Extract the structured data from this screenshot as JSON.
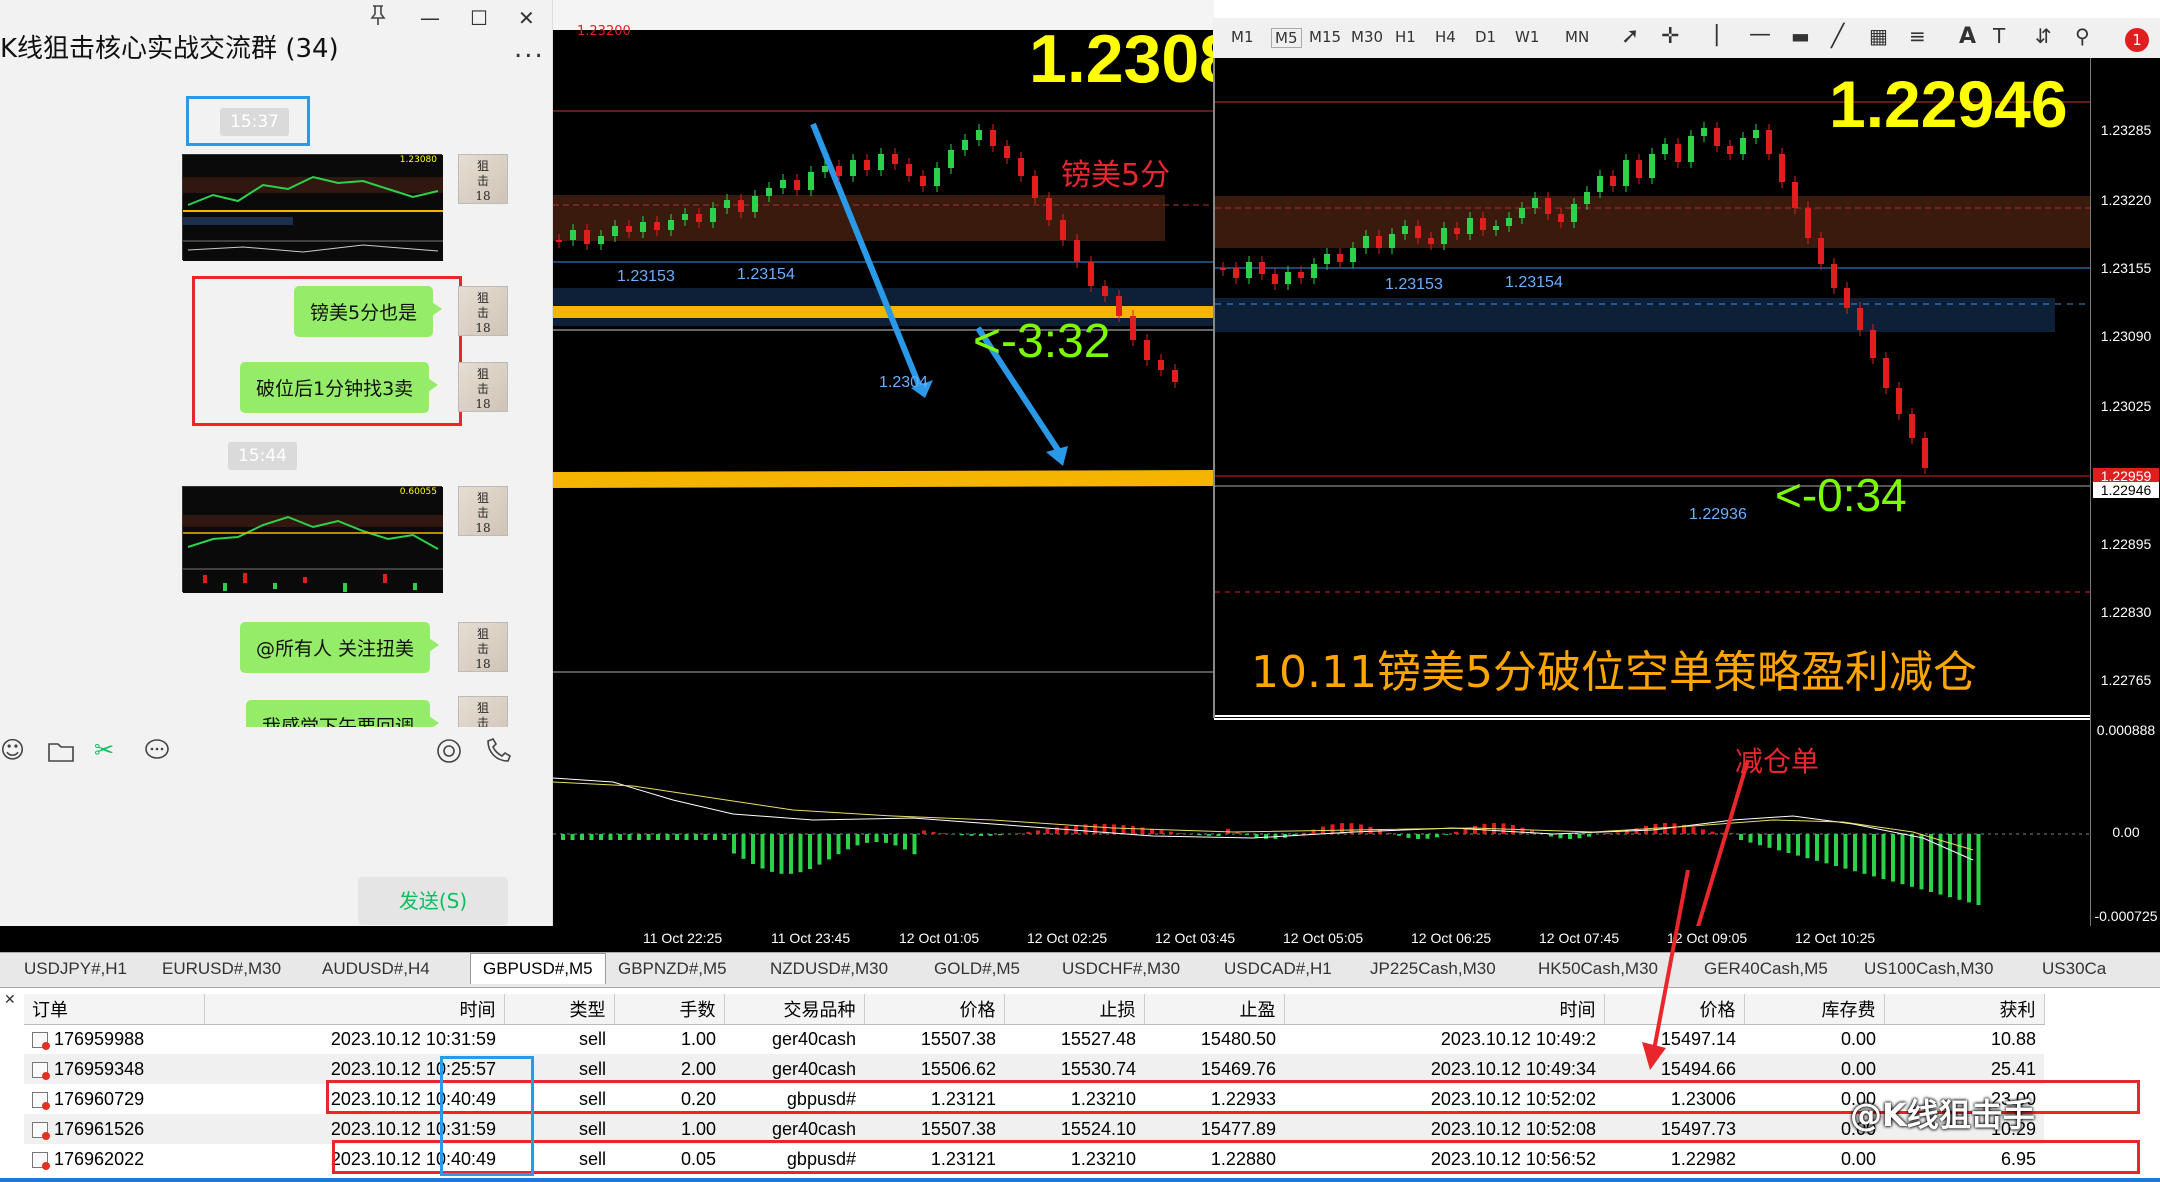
{
  "chat": {
    "title": "K线狙击核心实战交流群 (34)",
    "menu": "...",
    "time1": "15:37",
    "time2": "15:44",
    "msg1": "镑美5分也是",
    "msg2": "破位后1分钟找3卖",
    "msg3": "@所有人 关注扭美",
    "msg4": "我感觉下午要回调",
    "avatar_text": "狙击\n18",
    "send_label": "发送(S)",
    "thumb1_price": "1.23080",
    "thumb2_price": "0.60055"
  },
  "chart_left": {
    "top_price": "1.23200",
    "big_price": "1.2308",
    "label_cn": "镑美5分",
    "level1": "1.23153",
    "level2": "1.23154",
    "low_label": "1.2304",
    "timer": "<-3:32"
  },
  "chart_right": {
    "big_price": "1.22946",
    "level1": "1.23153",
    "level2": "1.23154",
    "low_label": "1.22936",
    "timer": "<-0:34",
    "headline": "10.11镑美5分破位空单策略盈利减仓"
  },
  "macd": {
    "label_cn": "减仓单",
    "scale_top": "0.000888",
    "scale_mid": "0.00",
    "scale_bot": "-0.000725"
  },
  "price_scale": [
    "1.23285",
    "1.23220",
    "1.23155",
    "1.23090",
    "1.23025",
    "1.22959",
    "1.22946",
    "1.22895",
    "1.22830",
    "1.22765"
  ],
  "time_axis": [
    "11 Oct 22:25",
    "11 Oct 23:45",
    "12 Oct 01:05",
    "12 Oct 02:25",
    "12 Oct 03:45",
    "12 Oct 05:05",
    "12 Oct 06:25",
    "12 Oct 07:45",
    "12 Oct 09:05",
    "12 Oct 10:25"
  ],
  "toolbar": {
    "timeframes": [
      "M1",
      "M5",
      "M15",
      "M30",
      "H1",
      "H4",
      "D1",
      "W1",
      "MN"
    ],
    "notif_count": "1"
  },
  "tabs": [
    "USDJPY#,H1",
    "EURUSD#,M30",
    "AUDUSD#,H4",
    "GBPUSD#,M5",
    "GBPNZD#,M5",
    "NZDUSD#,M30",
    "GOLD#,M5",
    "USDCHF#,M30",
    "USDCAD#,H1",
    "JP225Cash,M30",
    "HK50Cash,M30",
    "GER40Cash,M5",
    "US100Cash,M30",
    "US30Ca"
  ],
  "orders": {
    "headers": [
      "订单",
      "时间",
      "类型",
      "手数",
      "交易品种",
      "价格",
      "止损",
      "止盈",
      "时间",
      "价格",
      "库存费",
      "获利"
    ],
    "rows": [
      [
        "176959988",
        "2023.10.12 10:31:59",
        "sell",
        "1.00",
        "ger40cash",
        "15507.38",
        "15527.48",
        "15480.50",
        "2023.10.12 10:49:2",
        "15497.14",
        "0.00",
        "10.88"
      ],
      [
        "176959348",
        "2023.10.12 10:25:57",
        "sell",
        "2.00",
        "ger40cash",
        "15506.62",
        "15530.74",
        "15469.76",
        "2023.10.12 10:49:34",
        "15494.66",
        "0.00",
        "25.41"
      ],
      [
        "176960729",
        "2023.10.12 10:40:49",
        "sell",
        "0.20",
        "gbpusd#",
        "1.23121",
        "1.23210",
        "1.22933",
        "2023.10.12 10:52:02",
        "1.23006",
        "0.00",
        "23.00"
      ],
      [
        "176961526",
        "2023.10.12 10:31:59",
        "sell",
        "1.00",
        "ger40cash",
        "15507.38",
        "15524.10",
        "15477.89",
        "2023.10.12 10:52:08",
        "15497.73",
        "0.00",
        "10.29"
      ],
      [
        "176962022",
        "2023.10.12 10:40:49",
        "sell",
        "0.05",
        "gbpusd#",
        "1.23121",
        "1.23210",
        "1.22880",
        "2023.10.12 10:56:52",
        "1.22982",
        "0.00",
        "6.95"
      ]
    ]
  },
  "watermark": "@K线狙击手",
  "colors": {
    "bubble": "#95ec69",
    "bull": "#2bd24a",
    "bear": "#e01e1e",
    "price_yellow": "#ffff00",
    "headline_orange": "#ffa500",
    "annot_blue": "#2a9ae8",
    "annot_red": "#e8262c"
  }
}
